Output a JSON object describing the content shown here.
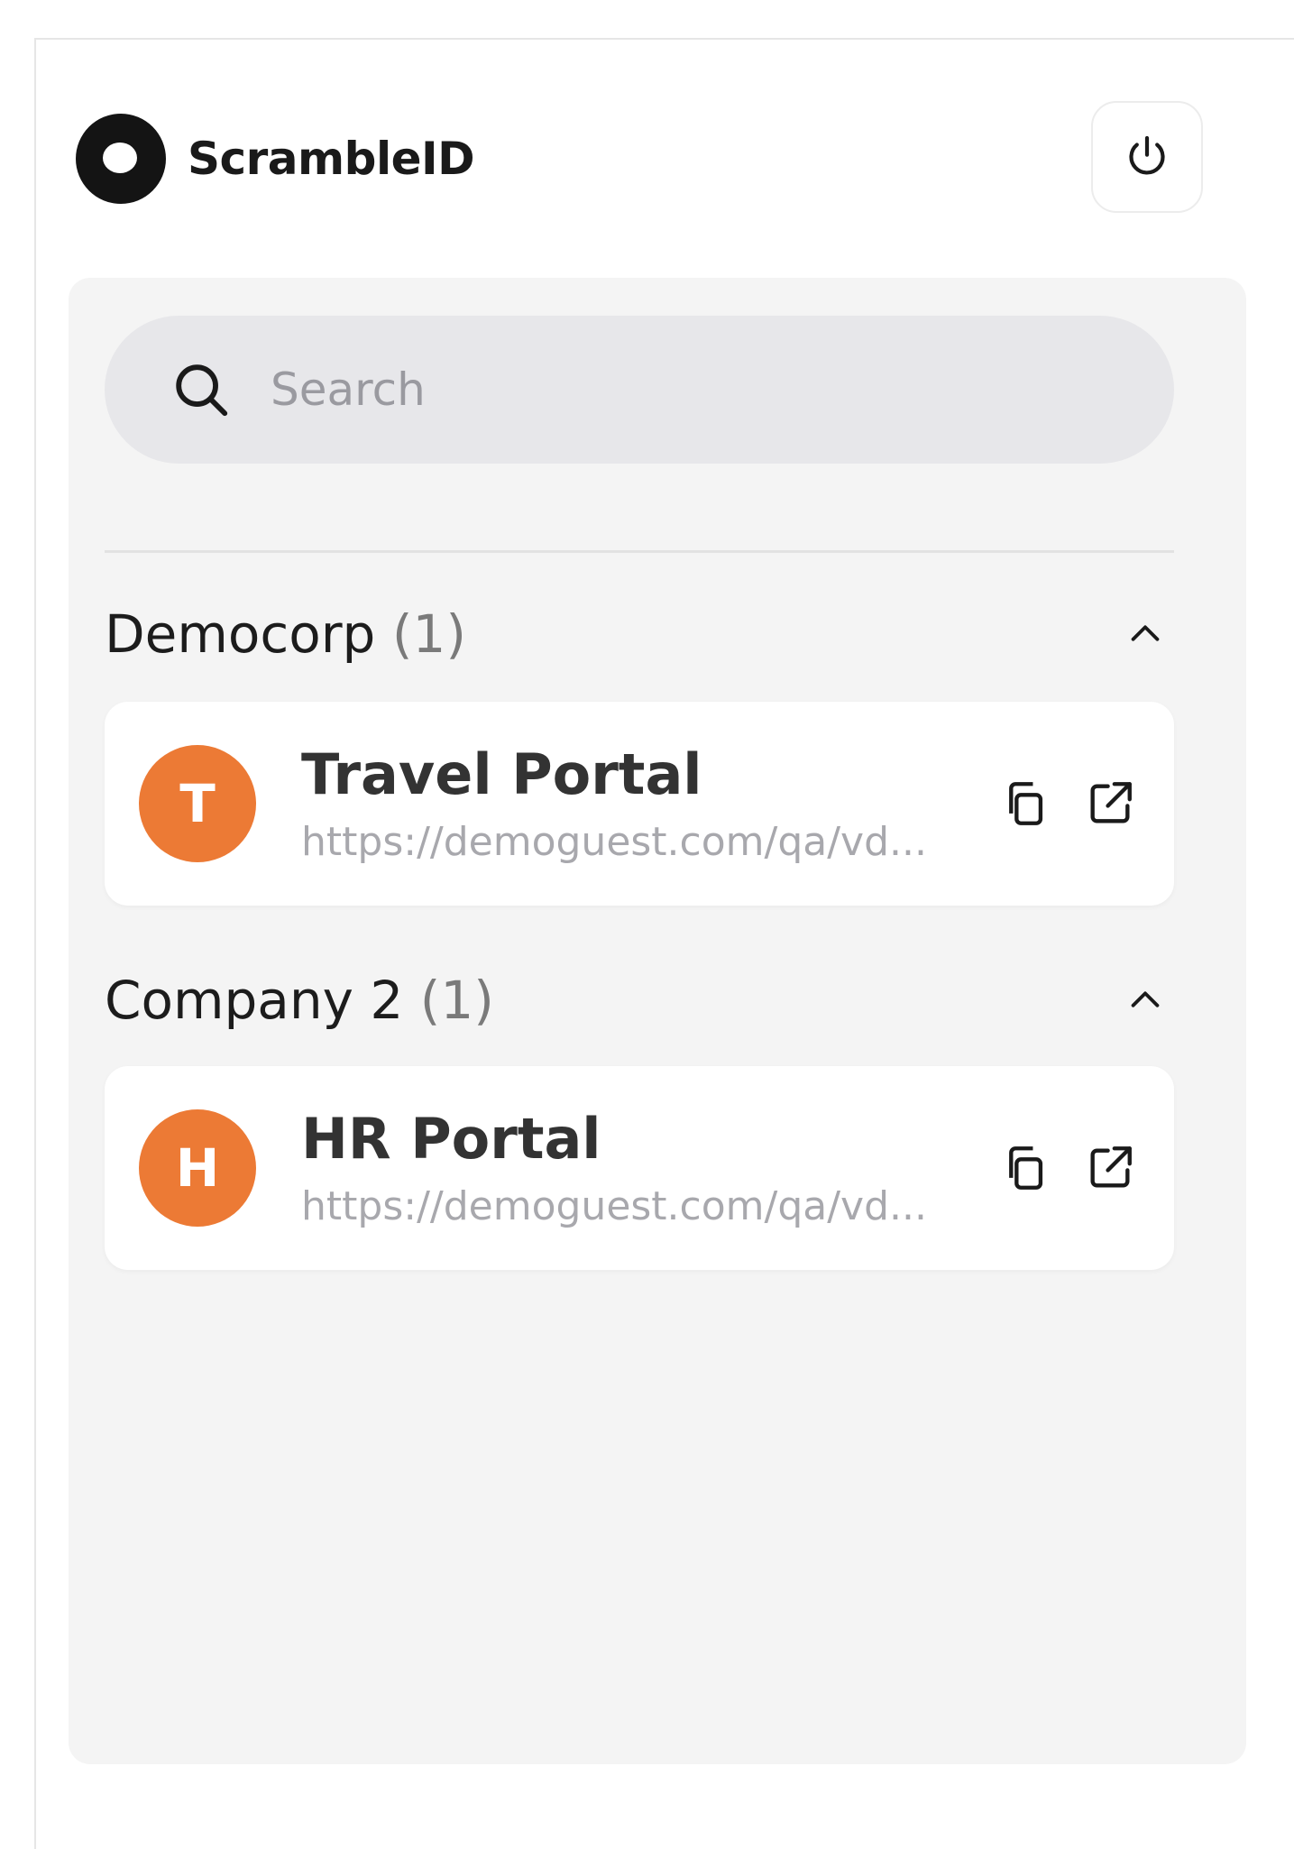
{
  "app": {
    "name": "ScrambleID"
  },
  "search": {
    "placeholder": "Search"
  },
  "groups": [
    {
      "name": "Democorp",
      "count": "(1)",
      "items": [
        {
          "initial": "T",
          "title": "Travel Portal",
          "url": "https://demoguest.com/qa/vd...",
          "avatar_color": "#ec7a35"
        }
      ]
    },
    {
      "name": "Company 2",
      "count": "(1)",
      "items": [
        {
          "initial": "H",
          "title": "HR Portal",
          "url": "https://demoguest.com/qa/vd...",
          "avatar_color": "#ec7a35"
        }
      ]
    }
  ],
  "icons": {
    "logo": "scrambleid-logo-icon",
    "power": "power-icon",
    "search": "search-icon",
    "collapse": "chevron-up-icon",
    "copy": "copy-icon",
    "open": "external-link-icon"
  }
}
